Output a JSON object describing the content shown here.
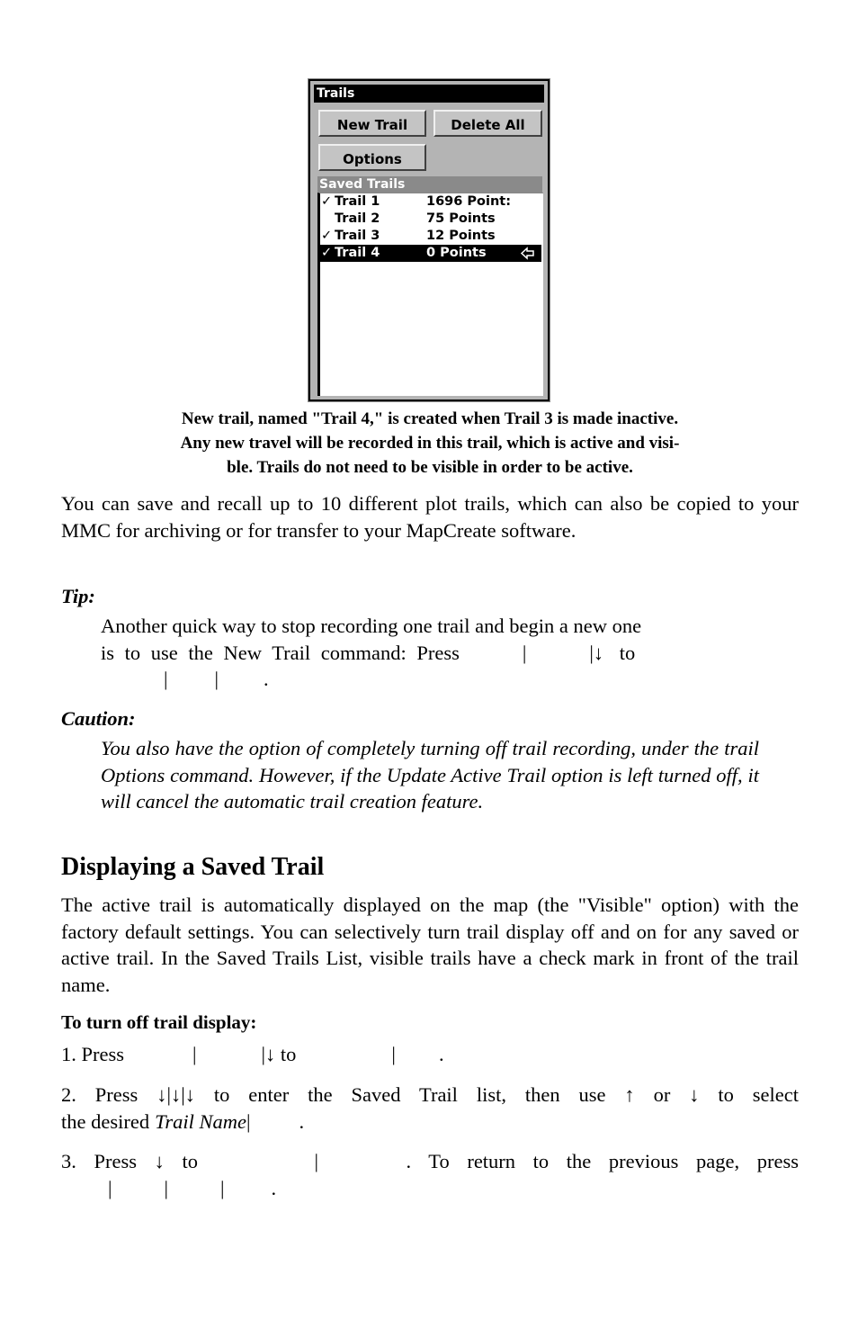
{
  "device_screen": {
    "title": "Trails",
    "buttons": {
      "new_trail": "New Trail",
      "delete_all": "Delete All",
      "options": "Options"
    },
    "saved_trails_header": "Saved Trails",
    "check_glyph": "✓",
    "scroll_icon": "left-arrow-icon",
    "trails": [
      {
        "name": "Trail 1",
        "points": "1696 Point:",
        "visible": true,
        "selected": false
      },
      {
        "name": "Trail 2",
        "points": "75 Points",
        "visible": false,
        "selected": false
      },
      {
        "name": "Trail 3",
        "points": "12 Points",
        "visible": true,
        "selected": false
      },
      {
        "name": "Trail 4",
        "points": "0 Points",
        "visible": true,
        "selected": true
      }
    ]
  },
  "caption": {
    "line1": "New trail, named \"Trail 4,\" is created when Trail 3 is made inactive.",
    "line2": "Any new travel will be recorded in this trail, which is active and visi-",
    "line3": "ble. Trails do not need to be visible in order to be active."
  },
  "intro_paragraph": "You can save and recall up to 10 different plot trails, which can also be copied to your MMC for archiving or for transfer to your MapCreate software.",
  "tip": {
    "label": "Tip:",
    "line1": "Another quick way to stop recording one trail and begin a new one",
    "line2_a": "is to use the New Trail command: Press",
    "line2_b": "|",
    "line2_c": "|↓ to",
    "line3_a": "|",
    "line3_b": "|",
    "line3_c": "."
  },
  "caution": {
    "label": "Caution:",
    "text": "You also have the option of completely turning off trail recording, under the trail Options command. However, if the Update Active Trail option is left turned off, it will cancel the automatic trail creation feature."
  },
  "section": {
    "title": "Displaying a Saved Trail",
    "paragraph": "The active trail is automatically displayed on the map (the \"Visible\" option) with the factory default settings. You can selectively turn trail display off and on for any saved or active trail. In the Saved Trails List, visible trails have a check mark in front of the trail name."
  },
  "procedure": {
    "title": "To turn off trail display:",
    "step1": {
      "a": "1. Press",
      "b": "|",
      "c": "|↓ to",
      "d": "|",
      "e": "."
    },
    "step2": {
      "a": "2. Press ↓|↓|↓ to enter the Saved Trail list, then use ↑ or ↓ to select",
      "b": "the desired",
      "c": "Trail Name",
      "d": "|",
      "e": "."
    },
    "step3": {
      "a": "3. Press ↓ to",
      "b": "|",
      "c": ". To return to the previous page, press",
      "d": "|",
      "e": "|",
      "f": "|",
      "g": "."
    }
  }
}
